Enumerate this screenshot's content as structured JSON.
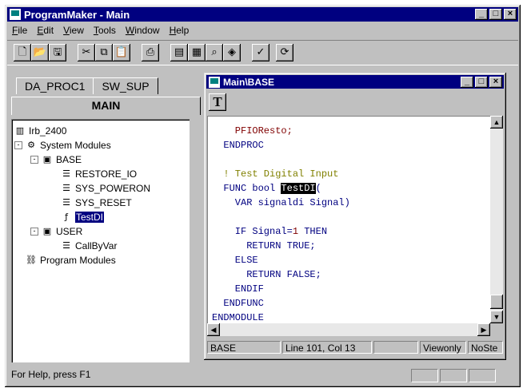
{
  "app": {
    "title": "ProgramMaker - Main"
  },
  "menu": [
    "File",
    "Edit",
    "View",
    "Tools",
    "Window",
    "Help"
  ],
  "toolbar": [
    "new-icon",
    "open-icon",
    "save-icon",
    "cut-icon",
    "copy-icon",
    "paste-icon",
    "print-icon",
    "document-icon",
    "table-icon",
    "find-icon",
    "module-icon",
    "check-icon",
    "refresh-icon"
  ],
  "tabs": {
    "t1": "DA_PROC1",
    "t2": "SW_SUP",
    "active": "MAIN"
  },
  "tree": {
    "root": "Irb_2400",
    "system_modules": "System Modules",
    "base": "BASE",
    "restore_io": "RESTORE_IO",
    "sys_poweron": "SYS_POWERON",
    "sys_reset": "SYS_RESET",
    "testdi": "TestDI",
    "user": "USER",
    "callbyvar": "CallByVar",
    "program_modules": "Program Modules"
  },
  "child": {
    "title": "Main\\BASE",
    "toolbar_t": "T",
    "code": {
      "l1": "    PFIOResto;",
      "l2": "  ENDPROC",
      "l3": "",
      "l4": "  ! Test Digital Input",
      "l5a": "  FUNC bool ",
      "l5b": "TestDI",
      "l5c": "(",
      "l6": "    VAR signaldi Signal)",
      "l7": "",
      "l8a": "    IF Signal=",
      "l8b": "1",
      "l8c": " THEN",
      "l9": "      RETURN TRUE;",
      "l10": "    ELSE",
      "l11": "      RETURN FALSE;",
      "l12": "    ENDIF",
      "l13": "  ENDFUNC",
      "l14": "ENDMODULE"
    },
    "status": {
      "module": "BASE",
      "pos": "Line 101, Col  13",
      "mode": "Viewonly",
      "extra": "NoSte"
    }
  },
  "status": {
    "help": "For Help, press F1"
  },
  "colors": {
    "titlebar": "#000080",
    "face": "#c0c0c0"
  }
}
